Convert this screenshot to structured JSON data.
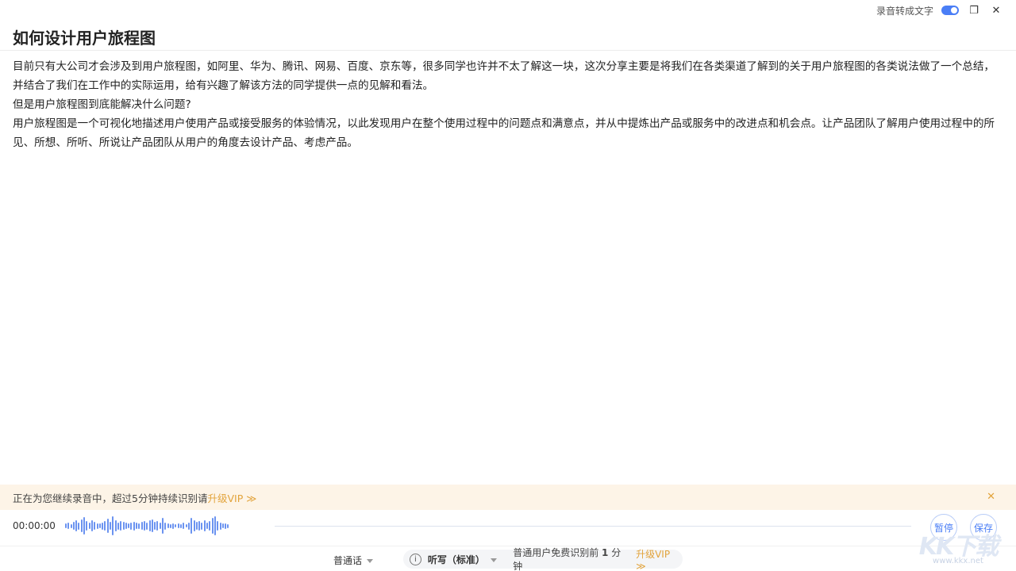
{
  "window": {
    "toggle_label": "录音转成文字",
    "toggle_on": true,
    "restore_icon": "❐",
    "close_icon": "✕"
  },
  "document": {
    "title": "如何设计用户旅程图",
    "paragraphs": [
      "目前只有大公司才会涉及到用户旅程图，如阿里、华为、腾讯、网易、百度、京东等，很多同学也许并不太了解这一块，这次分享主要是将我们在各类渠道了解到的关于用户旅程图的各类说法做了一个总结，并结合了我们在工作中的实际运用，给有兴趣了解该方法的同学提供一点的见解和看法。",
      "但是用户旅程图到底能解决什么问题?",
      "用户旅程图是一个可视化地描述用户使用产品或接受服务的体验情况，以此发现用户在整个使用过程中的问题点和满意点，并从中提炼出产品或服务中的改进点和机会点。让产品团队了解用户使用过程中的所见、所想、所听、所说让产品团队从用户的角度去设计产品、考虑产品。"
    ]
  },
  "notice": {
    "text": "正在为您继续录音中，超过5分钟持续识别请",
    "vip_link": "升级VIP ≫",
    "close_icon": "✕"
  },
  "recording": {
    "time": "00:00:00",
    "pause_label": "暂停",
    "save_label": "保存",
    "accent_color": "#4a7ef6"
  },
  "status_bar": {
    "language": "普通话",
    "info_icon": "i",
    "mode": "听写（标准）",
    "free_text": "普通用户免费识别前",
    "free_minutes": "1",
    "free_unit": "分钟",
    "vip_link": "升级VIP ≫"
  },
  "watermark": {
    "logo": "KK下载",
    "url": "www.kkx.net"
  }
}
